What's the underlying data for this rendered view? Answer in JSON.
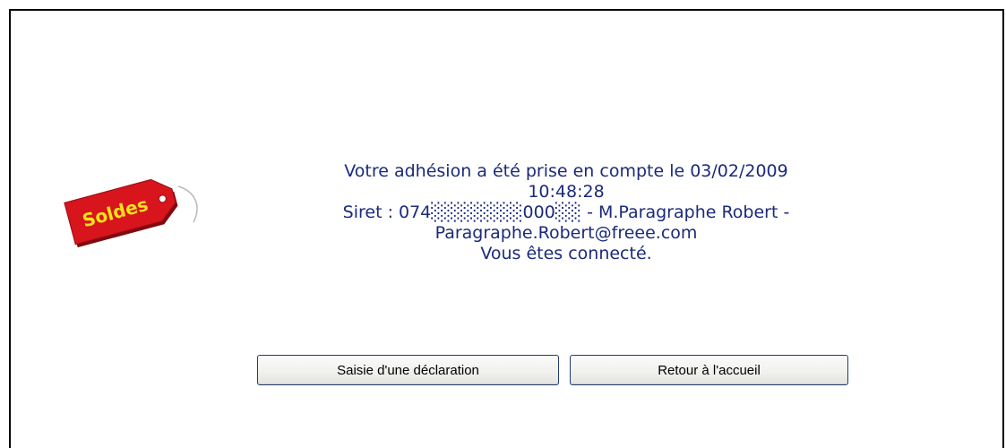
{
  "logo": {
    "text": "Soldes",
    "colors": {
      "tag_fill": "#d8141c",
      "tag_shadow": "#7e0b10",
      "text": "#f4e21a"
    }
  },
  "message": {
    "line1": "Votre adhésion a été prise en compte le 03/02/2009",
    "line2": "10:48:28",
    "line3": "Siret : 074░░░░░░░000░░ - M.Paragraphe Robert -",
    "line4": "Paragraphe.Robert@freee.com",
    "line5": "Vous êtes connecté."
  },
  "actions": {
    "declaration_label": "Saisie d'une déclaration",
    "home_label": "Retour à l'accueil"
  },
  "colors": {
    "message_text": "#1b2a7a",
    "button_border": "#243a75"
  }
}
